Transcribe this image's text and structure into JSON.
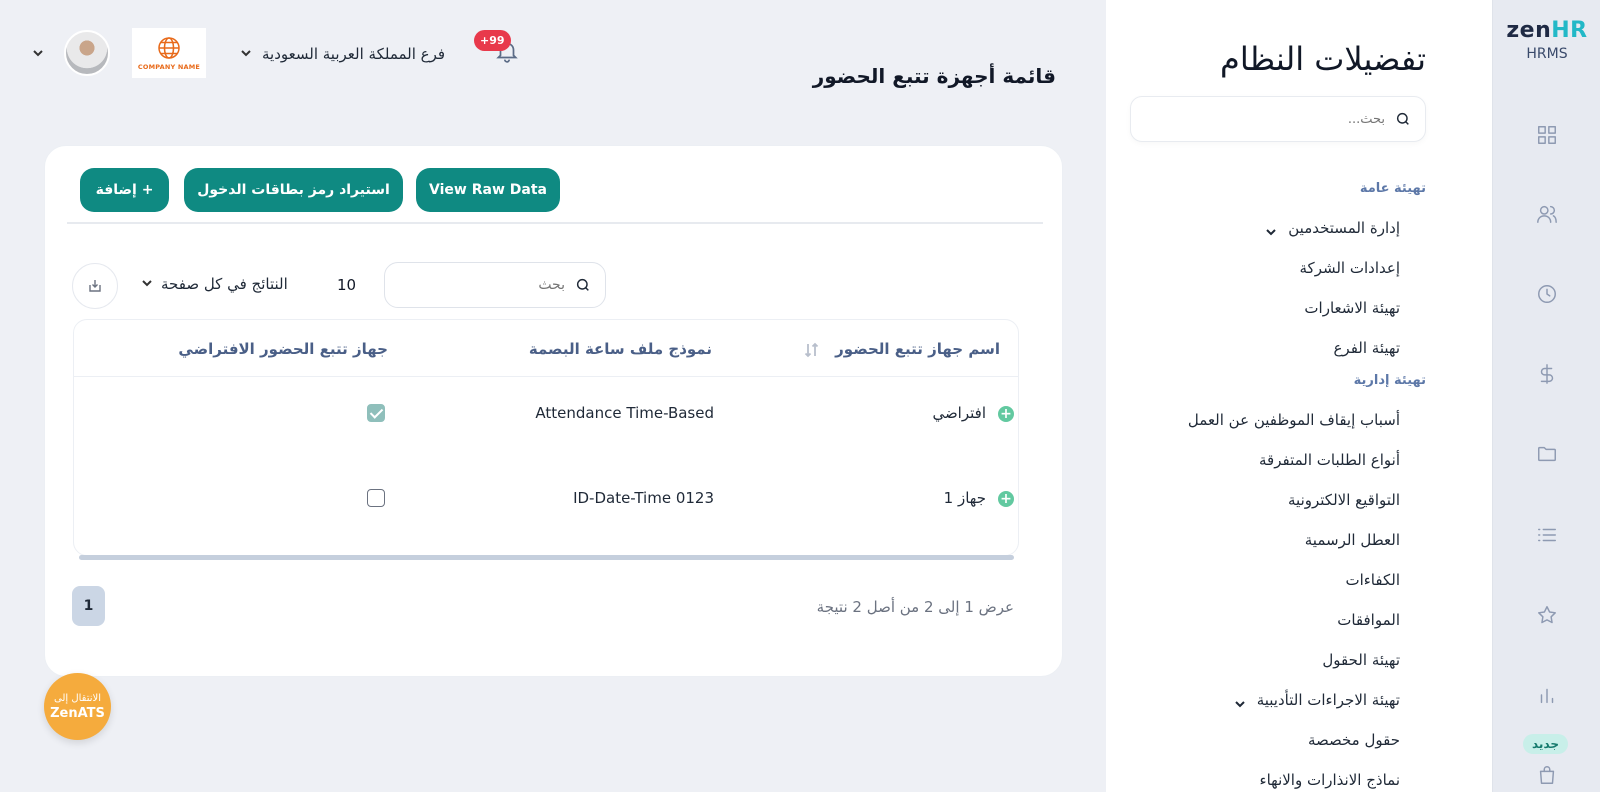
{
  "brand": {
    "logo_zen": "zen",
    "logo_hr": "HR",
    "product": "HRMS",
    "new_badge": "جديد"
  },
  "rail_icons": [
    "grid-icon",
    "users-icon",
    "clock-icon",
    "dollar-icon",
    "folder-icon",
    "list-icon",
    "star-icon",
    "chart-icon",
    "shopping-bag-icon"
  ],
  "settings": {
    "title": "تفضيلات النظام",
    "search_placeholder": "بحث...",
    "sections": [
      {
        "label": "تهيئة عامة",
        "items": [
          {
            "label": "إدارة المستخدمين",
            "has_chevron": true
          },
          {
            "label": "إعدادات الشركة"
          },
          {
            "label": "تهيئة الاشعارات"
          },
          {
            "label": "تهيئة الفرع"
          }
        ]
      },
      {
        "label": "تهيئة إدارية",
        "items": [
          {
            "label": "أسباب إيقاف الموظفين عن العمل"
          },
          {
            "label": "أنواع الطلبات المتفرقة"
          },
          {
            "label": "التواقيع الالكترونية"
          },
          {
            "label": "العطل الرسمية"
          },
          {
            "label": "الكفاءات"
          },
          {
            "label": "الموافقات"
          },
          {
            "label": "تهيئة الحقول"
          },
          {
            "label": "تهيئة الاجراءات التأديبية",
            "has_chevron": true
          },
          {
            "label": "حقول مخصصة"
          },
          {
            "label": "نماذج الانذارات والانهاء"
          }
        ]
      }
    ]
  },
  "header": {
    "branch": "فرع المملكة العربية السعودية",
    "notifications_badge": "+99",
    "company_logo_text": "COMPANY NAME",
    "page_title": "قائمة أجهزة تتبع الحضور"
  },
  "toolbar": {
    "add_label": "+ إضافة",
    "import_label": "استيراد رمز بطاقات الدخول",
    "raw_label": "View Raw Data"
  },
  "table_controls": {
    "per_page_label": "النتائج في كل صفحة",
    "per_page_value": "10",
    "search_placeholder": "بحث"
  },
  "table": {
    "columns": [
      "اسم جهاز تتبع الحضور",
      "نموذج ملف ساعة البصمة",
      "جهاز تتبع الحضور الافتراضي"
    ],
    "rows": [
      {
        "name": "افتراضي",
        "template": "Attendance Time-Based",
        "is_default": true
      },
      {
        "name": "جهاز 1",
        "template": "ID-Date-Time 0123",
        "is_default": false
      }
    ]
  },
  "pagination": {
    "current_page": "1",
    "summary": "عرض 1 إلى 2 من أصل 2 نتيجة"
  },
  "zenats": {
    "line1": "الانتقال إلى",
    "line2": "ZenATS"
  }
}
